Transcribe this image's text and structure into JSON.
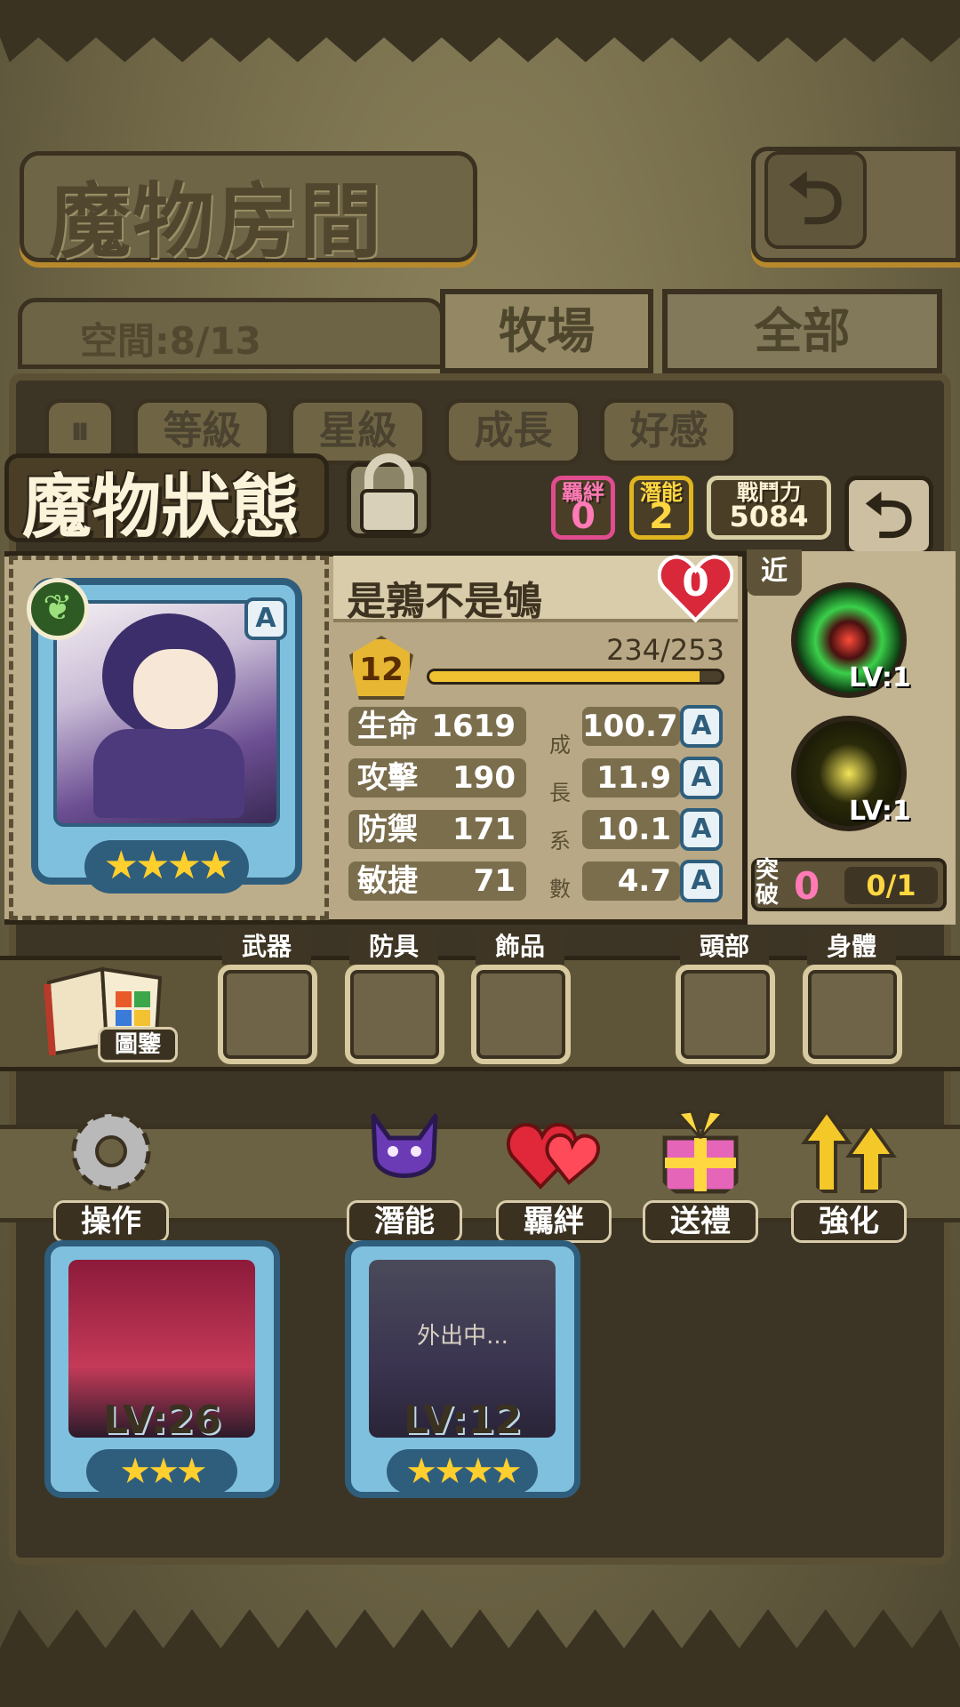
{
  "header": {
    "title": "魔物房間"
  },
  "room": {
    "space": "空間:8/13",
    "tabs": [
      "牧場",
      "全部"
    ],
    "sort_buttons": [
      "等級",
      "星級",
      "成長",
      "好感"
    ]
  },
  "status": {
    "title": "魔物狀態",
    "bond_label": "羈絆",
    "bond_value": "0",
    "potential_label": "潛能",
    "potential_value": "2",
    "power_label": "戰鬥力",
    "power_value": "5084"
  },
  "monster": {
    "name": "是鶉不是鴝",
    "affection": "0",
    "rank": "A",
    "level": "12",
    "exp_text": "234/253",
    "exp_ratio": 0.925,
    "stars": "★★★★",
    "growth_label": [
      "成",
      "長",
      "系",
      "數"
    ],
    "stats": [
      {
        "name": "生命",
        "value": "1619",
        "growth": "100.7",
        "grade": "A"
      },
      {
        "name": "攻擊",
        "value": "190",
        "growth": "11.9",
        "grade": "A"
      },
      {
        "name": "防禦",
        "value": "171",
        "growth": "10.1",
        "grade": "A"
      },
      {
        "name": "敏捷",
        "value": "71",
        "growth": "4.7",
        "grade": "A"
      }
    ]
  },
  "skills": {
    "tag": "近",
    "skill1_lv": "LV:1",
    "skill2_lv": "LV:1",
    "break_label": "突破",
    "break_value": "0",
    "break_ratio": "0/1"
  },
  "equipment": {
    "book_label": "圖鑒",
    "slots": [
      "武器",
      "防具",
      "飾品",
      "頭部",
      "身體"
    ]
  },
  "actions": [
    "操作",
    "潛能",
    "羈絆",
    "送禮",
    "強化"
  ],
  "monster_list": [
    {
      "level": "LV:26",
      "stars": "★★★",
      "status": ""
    },
    {
      "level": "LV:12",
      "stars": "★★★★",
      "status": "外出中..."
    }
  ],
  "colors": {
    "accent_gold": "#e7b632",
    "card_blue": "#7fc0de",
    "bond_pink": "#ff7ab6"
  }
}
